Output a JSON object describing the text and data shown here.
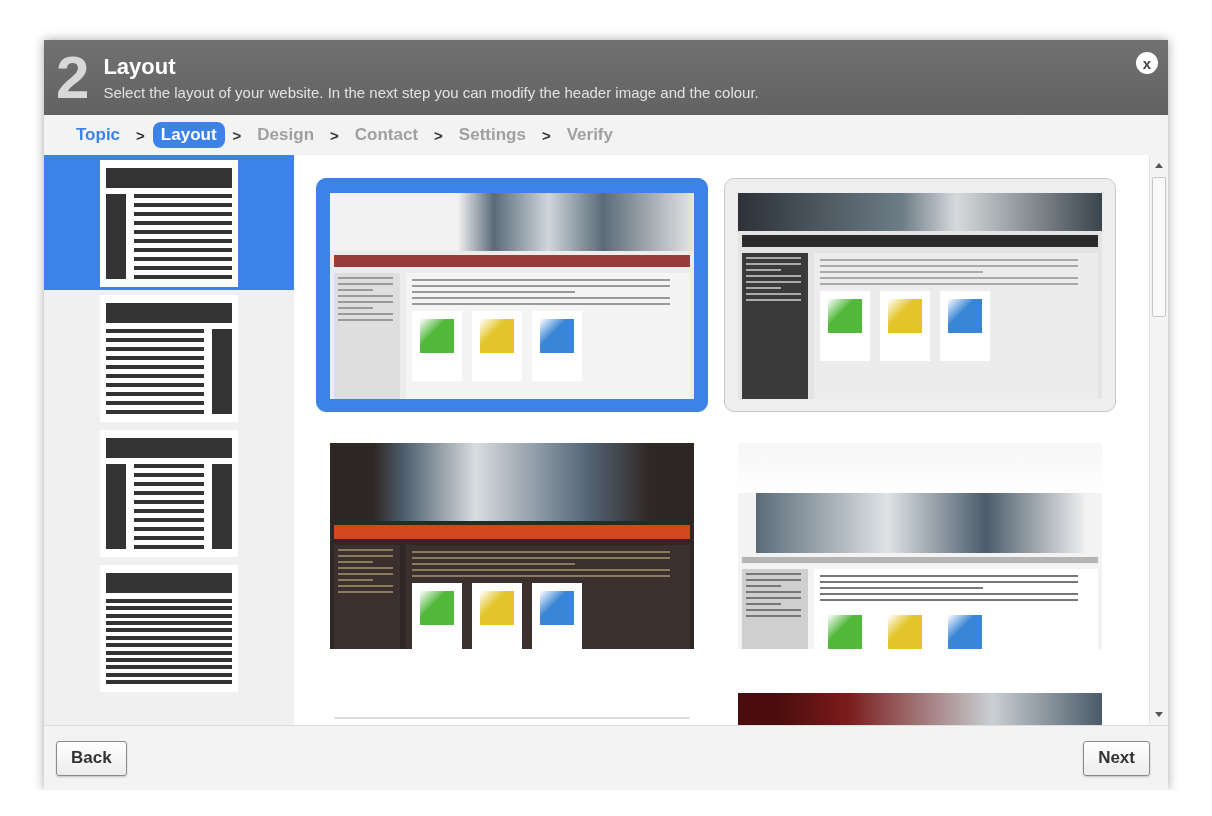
{
  "header": {
    "step_number": "2",
    "title": "Layout",
    "subtitle": "Select the layout of your website. In the next step you can modify the header image and the colour.",
    "close": "x"
  },
  "steps": [
    {
      "label": "Topic",
      "visited": true,
      "selected": false
    },
    {
      "separator": ">",
      "label": "Layout",
      "visited": true,
      "selected": true
    },
    {
      "separator": ">",
      "label": "Design",
      "visited": false,
      "selected": false
    },
    {
      "separator": ">",
      "label": "Contact",
      "visited": false,
      "selected": false
    },
    {
      "separator": ">",
      "label": "Settings",
      "visited": false,
      "selected": false
    },
    {
      "separator": ">",
      "label": "Verify",
      "visited": false,
      "selected": false
    }
  ],
  "layouts": [
    {
      "kind": "left-column",
      "selected": true
    },
    {
      "kind": "right-column",
      "selected": false
    },
    {
      "kind": "two-columns",
      "selected": false
    },
    {
      "kind": "no-column",
      "selected": false
    }
  ],
  "templates": [
    {
      "kind": "light-red-menu",
      "selected": true,
      "hovered": false
    },
    {
      "kind": "dark-header",
      "selected": false,
      "hovered": true
    },
    {
      "kind": "brown-orange",
      "selected": false,
      "hovered": false
    },
    {
      "kind": "white-banner",
      "selected": false,
      "hovered": false
    },
    {
      "kind": "white-minimal",
      "selected": false,
      "hovered": false
    },
    {
      "kind": "maroon",
      "selected": false,
      "hovered": false
    }
  ],
  "buttons": {
    "back": "Back",
    "next": "Next"
  }
}
